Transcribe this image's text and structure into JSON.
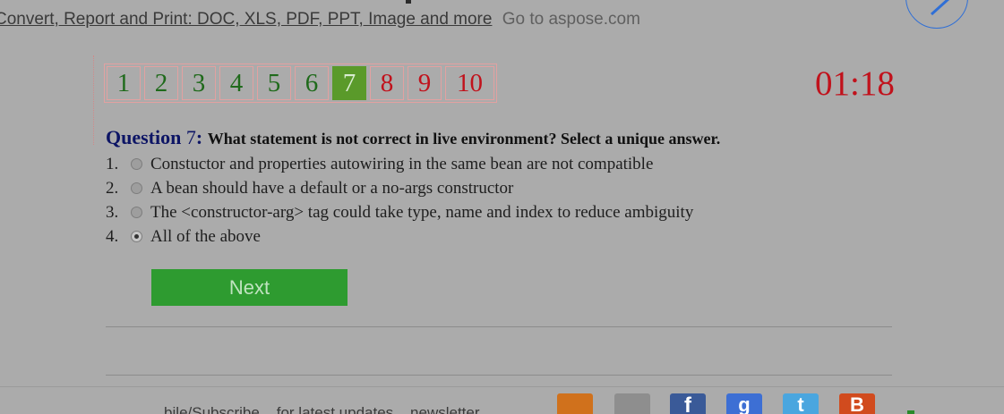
{
  "ad": {
    "link_text": "Convert, Report and Print: DOC, XLS, PDF, PPT, Image and more",
    "goto_text": "Go to aspose.com"
  },
  "quiz": {
    "nav": [
      {
        "label": "1",
        "state": "done"
      },
      {
        "label": "2",
        "state": "done"
      },
      {
        "label": "3",
        "state": "done"
      },
      {
        "label": "4",
        "state": "done"
      },
      {
        "label": "5",
        "state": "done"
      },
      {
        "label": "6",
        "state": "done"
      },
      {
        "label": "7",
        "state": "current"
      },
      {
        "label": "8",
        "state": "todo"
      },
      {
        "label": "9",
        "state": "todo"
      },
      {
        "label": "10",
        "state": "todo"
      }
    ],
    "timer": "01:18",
    "question_label": "Question",
    "question_number": "7",
    "question_colon": ":",
    "question_text": "What statement is not correct in live environment? Select a unique answer.",
    "answers": [
      {
        "num": "1.",
        "text": "Constuctor and properties autowiring in the same bean are not compatible",
        "checked": false
      },
      {
        "num": "2.",
        "text": "A bean should have a default or a no-args constructor",
        "checked": false
      },
      {
        "num": "3.",
        "text": "The <constructor-arg> tag could take type, name and index to reduce ambiguity",
        "checked": false
      },
      {
        "num": "4.",
        "text": "All of the above",
        "checked": true
      }
    ],
    "next_label": "Next"
  },
  "footer": {
    "text": "... ...bile/Subscribe ...for latest updates ...newsletter",
    "social": [
      {
        "name": "rss-icon",
        "glyph": ""
      },
      {
        "name": "email-icon",
        "glyph": ""
      },
      {
        "name": "facebook-icon",
        "glyph": "f"
      },
      {
        "name": "google-plus-icon",
        "glyph": "g"
      },
      {
        "name": "twitter-icon",
        "glyph": "t"
      },
      {
        "name": "blogger-icon",
        "glyph": "B"
      }
    ]
  },
  "colors": {
    "background": "#ababab",
    "accent_green": "#2e9b30",
    "timer_red": "#c1121c",
    "question_blue": "#0d1565"
  }
}
